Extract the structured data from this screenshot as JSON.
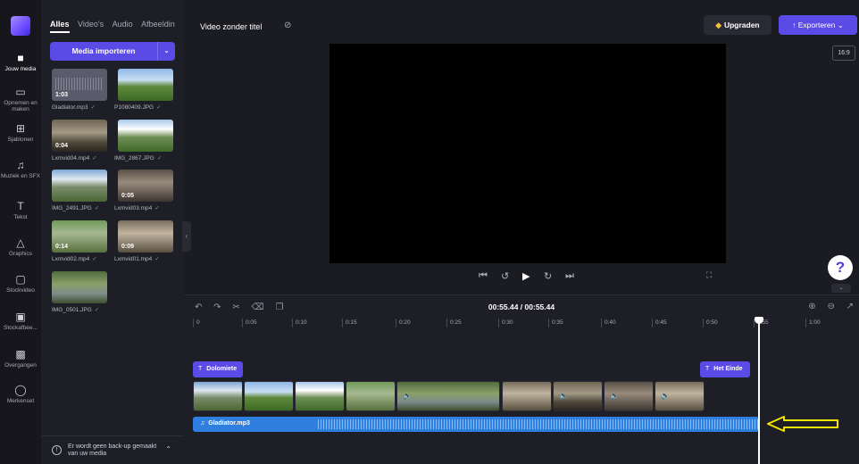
{
  "rail": {
    "items": [
      {
        "label": "Jouw media",
        "icon": "folder-icon"
      },
      {
        "label": "Opnemen en maken",
        "icon": "camera-icon"
      },
      {
        "label": "Sjablonen",
        "icon": "templates-icon"
      },
      {
        "label": "Muziek en SFX",
        "icon": "music-icon"
      },
      {
        "label": "Tekst",
        "icon": "text-icon"
      },
      {
        "label": "Graphics",
        "icon": "shapes-icon"
      },
      {
        "label": "Stockvideo",
        "icon": "video-icon"
      },
      {
        "label": "Stockafbee...",
        "icon": "image-icon"
      },
      {
        "label": "Overgangen",
        "icon": "transitions-icon"
      },
      {
        "label": "Merkenset",
        "icon": "brand-icon"
      }
    ]
  },
  "media": {
    "tabs": [
      "Alles",
      "Video's",
      "Audio",
      "Afbeeldin"
    ],
    "import_label": "Media importeren",
    "items": [
      {
        "label": "Gladiator.mp3",
        "duration": "1:03"
      },
      {
        "label": "P1080409.JPG",
        "duration": ""
      },
      {
        "label": "Lxmvid04.mp4",
        "duration": "0:04"
      },
      {
        "label": "IMG_2867.JPG",
        "duration": ""
      },
      {
        "label": "IMG_2491.JPG",
        "duration": ""
      },
      {
        "label": "Lxmvid03.mp4",
        "duration": "0:05"
      },
      {
        "label": "Lxmvid02.mp4",
        "duration": "0:14"
      },
      {
        "label": "Lxmvid01.mp4",
        "duration": "0:09"
      },
      {
        "label": "IMG_0501.JPG",
        "duration": ""
      }
    ],
    "backup_text": "Er wordt geen back-up gemaakt van uw media"
  },
  "topbar": {
    "project_title": "Video zonder titel",
    "upgrade_label": "Upgraden",
    "export_label": "Exporteren",
    "ratio": "16:9"
  },
  "help": {
    "label": "?"
  },
  "timeline": {
    "timecode": "00:55.44 / 00:55.44",
    "ruler": [
      "0",
      "0:05",
      "0:10",
      "0:15",
      "0:20",
      "0:25",
      "0:30",
      "0:35",
      "0:40",
      "0:45",
      "0:50",
      "0:55",
      "1:00"
    ],
    "text_clips": [
      "Dolomiete",
      "Het Einde"
    ],
    "audio_clip": "Gladiator.mp3"
  },
  "colors": {
    "accent": "#5b4be6",
    "audio": "#2f7fe0",
    "annotation": "#f2e600"
  }
}
